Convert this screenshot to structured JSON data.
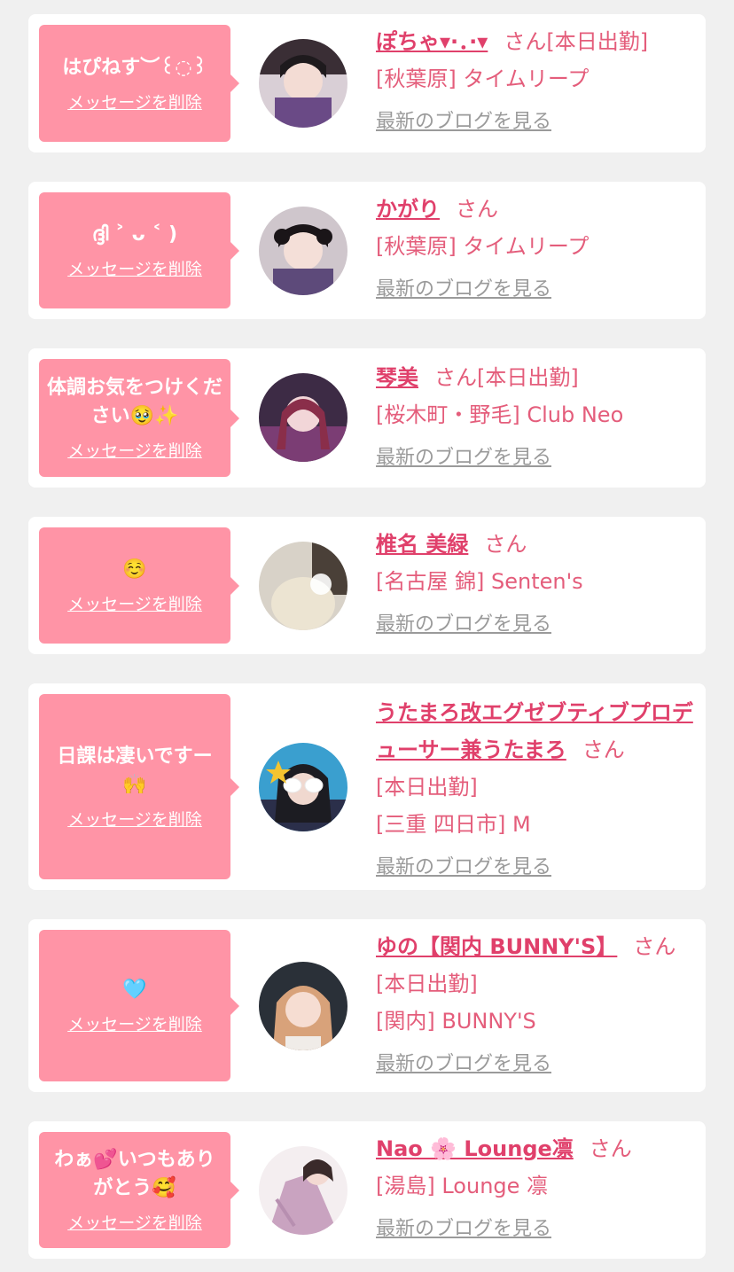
{
  "common": {
    "delete_label": "メッセージを削除",
    "san_label": "さん",
    "blog_label": "最新のブログを見る"
  },
  "cards": [
    {
      "message": "はぴねす︶꒰◌꒱",
      "name": "ぽちゃ▾·．·▾",
      "name_suffix": "[本日出勤]",
      "lines": [
        "[秋葉原] タイムリープ"
      ]
    },
    {
      "message": "ദ്ദി ˃ ᴗ ˂ )",
      "name": "かがり",
      "name_suffix": "",
      "lines": [
        "[秋葉原] タイムリープ"
      ]
    },
    {
      "message": "体調お気をつけください🥹✨",
      "name": "琴美",
      "name_suffix": "[本日出勤]",
      "lines": [
        "[桜木町・野毛] Club Neo"
      ]
    },
    {
      "message": "☺️",
      "name": "椎名 美緑",
      "name_suffix": "",
      "lines": [
        "[名古屋 錦] Senten's"
      ]
    },
    {
      "message": "日課は凄いですー🙌",
      "name": "うたまろ改エグゼブティブプロデューサー兼うたまろ",
      "name_suffix": "",
      "lines": [
        "[本日出勤]",
        "[三重 四日市] M"
      ]
    },
    {
      "message": "🩵",
      "name": "ゆの【関内 BUNNY'S】",
      "name_suffix": "",
      "lines": [
        "[本日出勤]",
        "[関内] BUNNY'S"
      ]
    },
    {
      "message": "わぁ💕いつもありがとう🥰",
      "name": "Nao 🌸 Lounge凛",
      "name_suffix": "",
      "lines": [
        "[湯島] Lounge 凛"
      ]
    }
  ]
}
